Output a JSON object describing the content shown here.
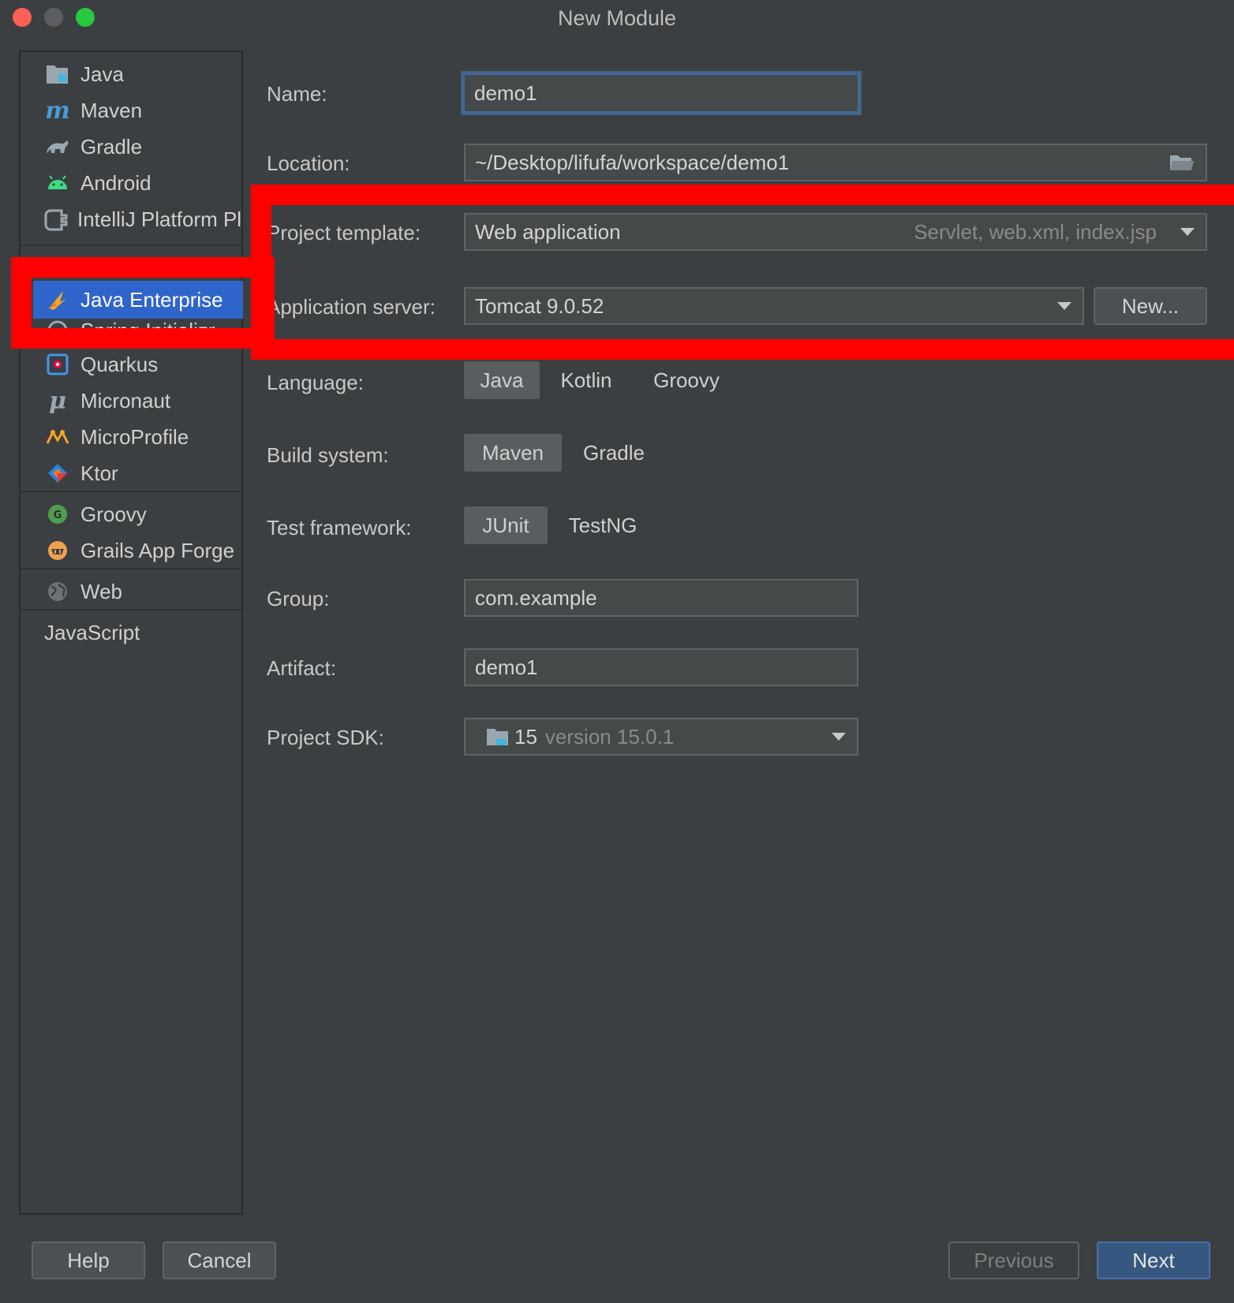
{
  "window": {
    "title": "New Module",
    "buttons": [
      "close",
      "minimize",
      "maximize"
    ]
  },
  "sidebar": {
    "items": [
      {
        "label": "Java",
        "icon": "java-folder-icon",
        "color": "#5fa0d0"
      },
      {
        "label": "Maven",
        "icon": "maven-icon",
        "color": "#4a9bd6"
      },
      {
        "label": "Gradle",
        "icon": "gradle-icon",
        "color": "#9aa7b0"
      },
      {
        "label": "Android",
        "icon": "android-icon",
        "color": "#3ddc84"
      },
      {
        "label": "IntelliJ Platform Plugin",
        "icon": "plugin-icon",
        "color": "#9aa7b0"
      },
      {
        "label": "Java Enterprise",
        "icon": "java-enterprise-icon",
        "color": "#f5a623",
        "selected": true
      },
      {
        "label": "Spring Initializr",
        "icon": "spring-icon",
        "color": "#6db33f"
      },
      {
        "label": "Quarkus",
        "icon": "quarkus-icon",
        "color": "#4695eb"
      },
      {
        "label": "Micronaut",
        "icon": "micronaut-icon",
        "color": "#9aa7b0"
      },
      {
        "label": "MicroProfile",
        "icon": "microprofile-icon",
        "color": "#f5a623"
      },
      {
        "label": "Ktor",
        "icon": "ktor-icon",
        "color": "#f47a1f"
      },
      {
        "label": "Groovy",
        "icon": "groovy-icon",
        "color": "#4f9e4f"
      },
      {
        "label": "Grails App Forge",
        "icon": "grails-icon",
        "color": "#f0a050"
      },
      {
        "label": "Web",
        "icon": "globe-icon",
        "color": "#9aa7b0"
      },
      {
        "label": "JavaScript",
        "icon": "",
        "color": ""
      }
    ]
  },
  "form": {
    "name_label": "Name:",
    "name_value": "demo1",
    "location_label": "Location:",
    "location_value": "~/Desktop/lifufa/workspace/demo1",
    "template_label": "Project template:",
    "template_value": "Web application",
    "template_hint": "Servlet, web.xml, index.jsp",
    "server_label": "Application server:",
    "server_value": "Tomcat 9.0.52",
    "server_new_button": "New...",
    "language_label": "Language:",
    "language_options": [
      "Java",
      "Kotlin",
      "Groovy"
    ],
    "language_selected": "Java",
    "build_label": "Build system:",
    "build_options": [
      "Maven",
      "Gradle"
    ],
    "build_selected": "Maven",
    "test_label": "Test framework:",
    "test_options": [
      "JUnit",
      "TestNG"
    ],
    "test_selected": "JUnit",
    "group_label": "Group:",
    "group_value": "com.example",
    "artifact_label": "Artifact:",
    "artifact_value": "demo1",
    "sdk_label": "Project SDK:",
    "sdk_value": "15",
    "sdk_version": "version 15.0.1"
  },
  "footer": {
    "help": "Help",
    "cancel": "Cancel",
    "previous": "Previous",
    "next": "Next"
  },
  "colors": {
    "background": "#3c3f41",
    "selection": "#2f65ca",
    "annotation": "#ff0000",
    "primary_button": "#365880"
  }
}
